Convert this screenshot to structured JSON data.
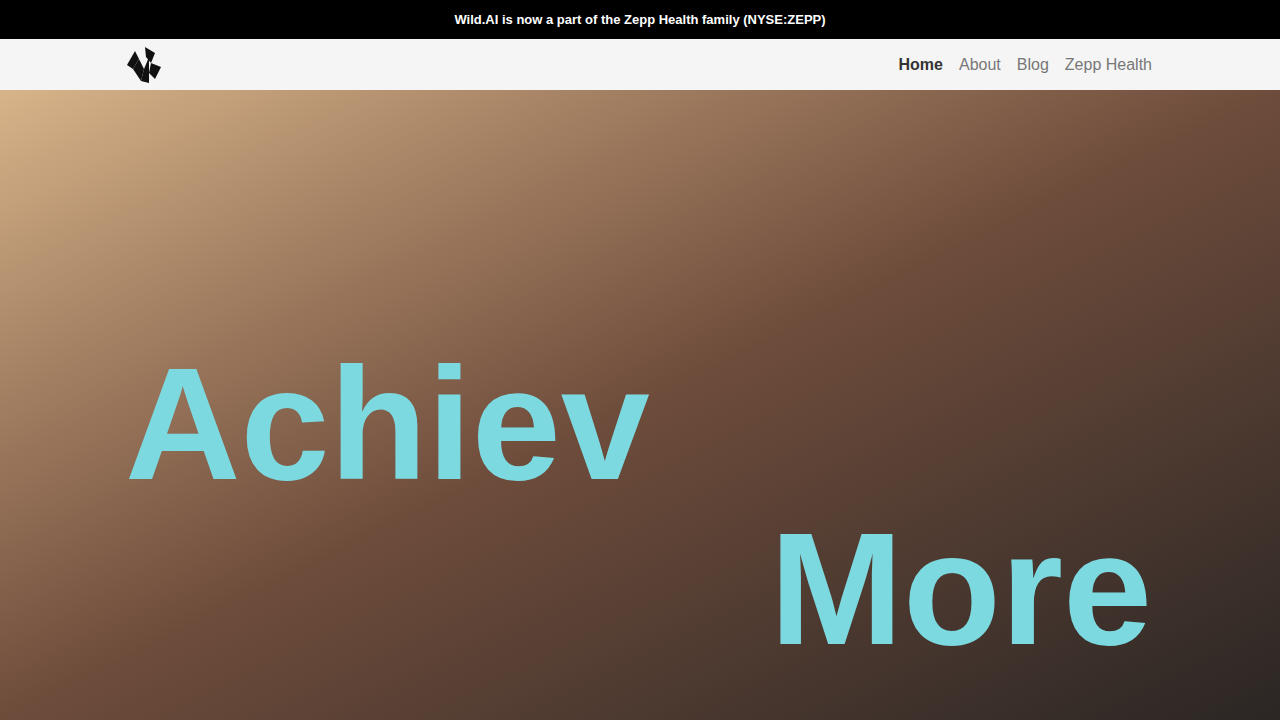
{
  "banner": "Wild.AI is now a part of the Zepp Health family (NYSE:ZEPP)",
  "nav": {
    "items": [
      {
        "label": "Home",
        "selected": true
      },
      {
        "label": "About",
        "selected": false
      },
      {
        "label": "Blog",
        "selected": false
      },
      {
        "label": "Zepp Health",
        "selected": false
      }
    ]
  },
  "hero": {
    "lines": [
      "Achiev",
      "More"
    ]
  }
}
